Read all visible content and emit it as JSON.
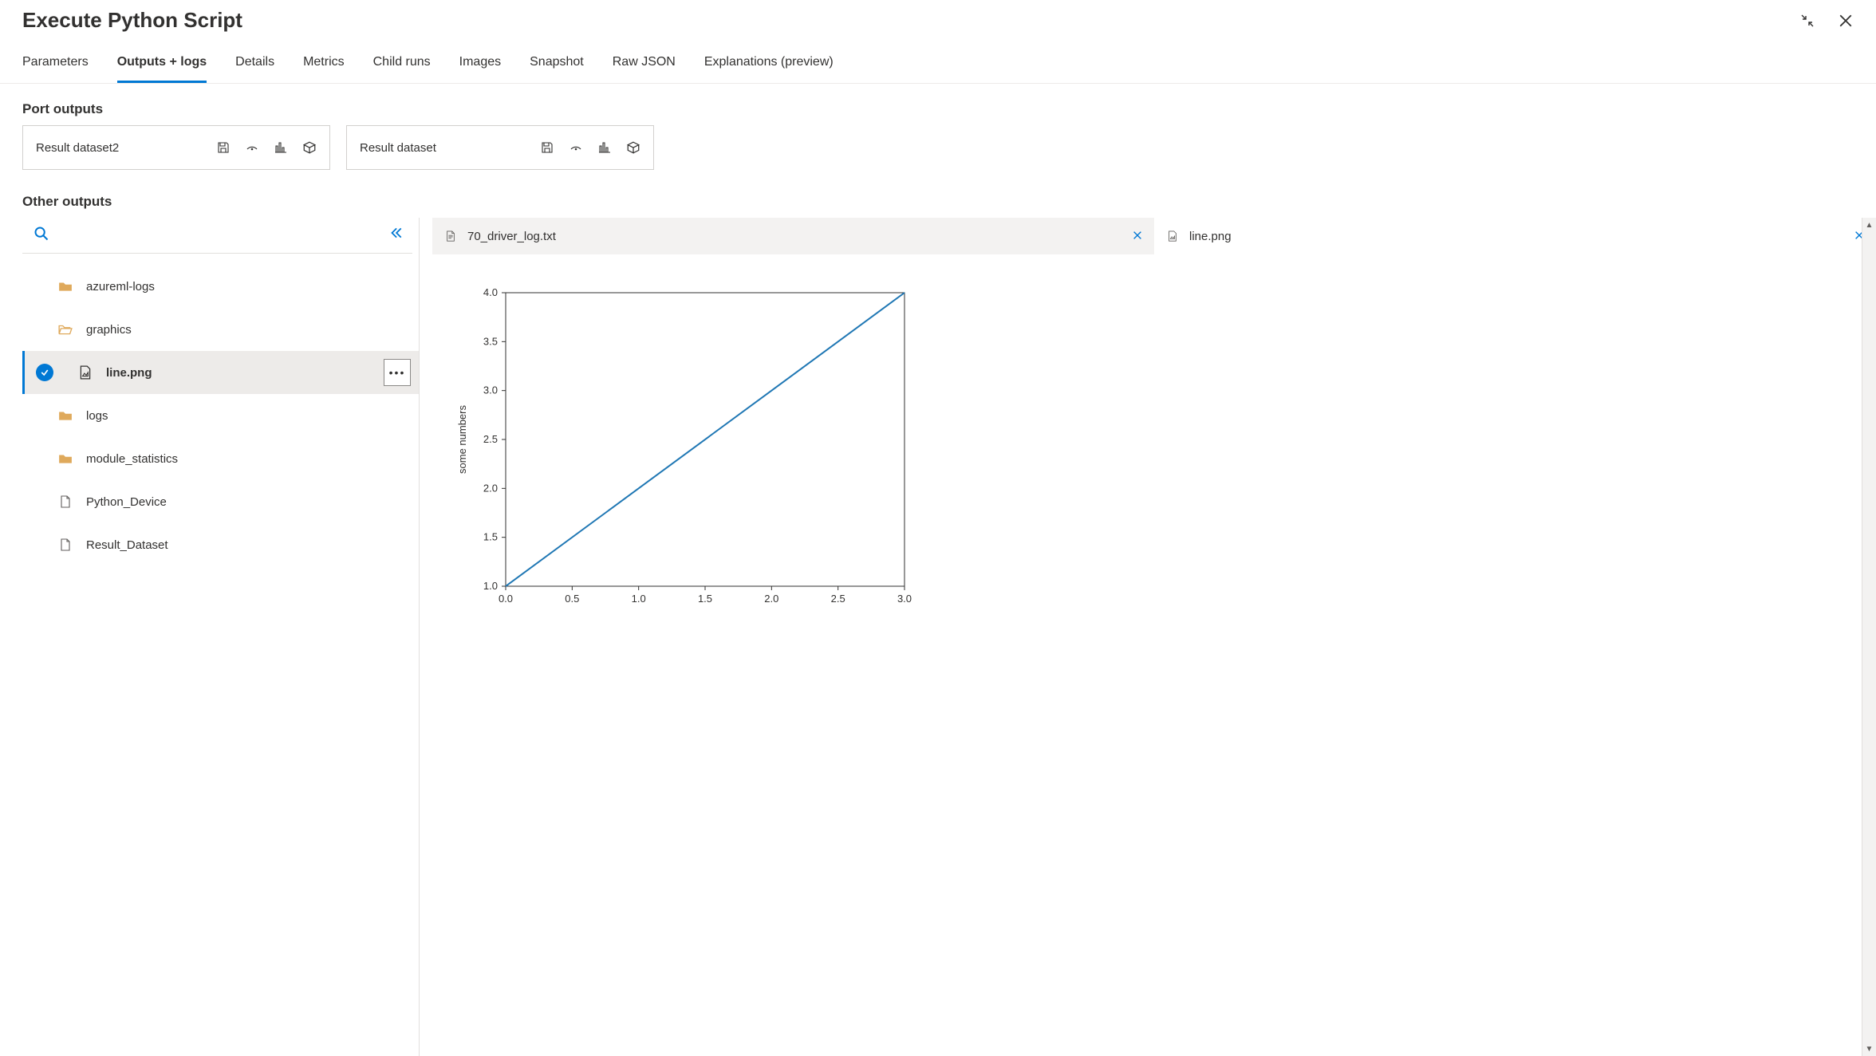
{
  "header": {
    "title": "Execute Python Script"
  },
  "tabs": [
    {
      "label": "Parameters"
    },
    {
      "label": "Outputs + logs",
      "active": true
    },
    {
      "label": "Details"
    },
    {
      "label": "Metrics"
    },
    {
      "label": "Child runs"
    },
    {
      "label": "Images"
    },
    {
      "label": "Snapshot"
    },
    {
      "label": "Raw JSON"
    },
    {
      "label": "Explanations (preview)"
    }
  ],
  "sections": {
    "port_outputs_label": "Port outputs",
    "other_outputs_label": "Other outputs"
  },
  "port_outputs": [
    {
      "name": "Result dataset2"
    },
    {
      "name": "Result dataset"
    }
  ],
  "tree": [
    {
      "label": "azureml-logs",
      "kind": "folder"
    },
    {
      "label": "graphics",
      "kind": "folder-open"
    },
    {
      "label": "line.png",
      "kind": "image",
      "selected": true
    },
    {
      "label": "logs",
      "kind": "folder"
    },
    {
      "label": "module_statistics",
      "kind": "folder"
    },
    {
      "label": "Python_Device",
      "kind": "file"
    },
    {
      "label": "Result_Dataset",
      "kind": "file"
    }
  ],
  "file_tabs": [
    {
      "label": "70_driver_log.txt",
      "icon": "file",
      "active": true
    },
    {
      "label": "line.png",
      "icon": "image"
    }
  ],
  "chart_data": {
    "type": "line",
    "x": [
      0.0,
      1.0,
      2.0,
      3.0
    ],
    "values": [
      1.0,
      2.0,
      3.0,
      4.0
    ],
    "xlim": [
      0.0,
      3.0
    ],
    "ylim": [
      1.0,
      4.0
    ],
    "xticks": [
      0.0,
      0.5,
      1.0,
      1.5,
      2.0,
      2.5,
      3.0
    ],
    "yticks": [
      1.0,
      1.5,
      2.0,
      2.5,
      3.0,
      3.5,
      4.0
    ],
    "ylabel": "some numbers",
    "line_color": "#1f77b4"
  }
}
